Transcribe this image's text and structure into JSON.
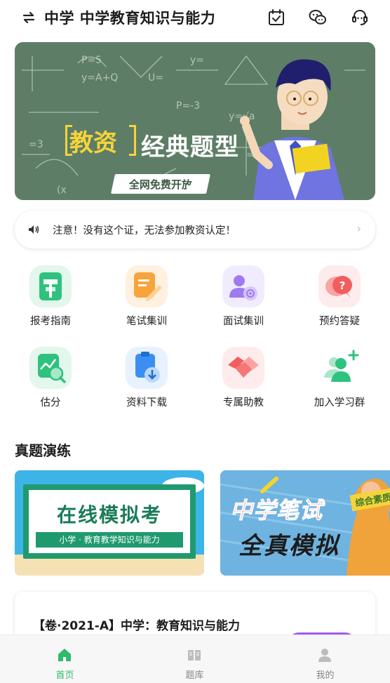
{
  "header": {
    "title": "中学 中学教育知识与能力",
    "icons": [
      "swap-icon",
      "calendar-check-icon",
      "wechat-icon",
      "customer-service-icon"
    ]
  },
  "banner": {
    "tag": "教资",
    "title": "经典题型",
    "ribbon": "全网免费开放",
    "slides": 2,
    "active_slide": 1
  },
  "notice": {
    "text": "注意！没有这个证，无法参加教资认定！"
  },
  "menu": [
    {
      "label": "报考指南",
      "icon": "signpost-icon"
    },
    {
      "label": "笔试集训",
      "icon": "notepad-pencil-icon"
    },
    {
      "label": "面试集训",
      "icon": "user-target-icon"
    },
    {
      "label": "预约答疑",
      "icon": "question-bubble-icon"
    },
    {
      "label": "估分",
      "icon": "chart-magnifier-icon"
    },
    {
      "label": "资料下载",
      "icon": "clipboard-download-icon"
    },
    {
      "label": "专属助教",
      "icon": "handshake-icon"
    },
    {
      "label": "加入学习群",
      "icon": "add-group-icon"
    }
  ],
  "section": {
    "title": "真题演练"
  },
  "cards": [
    {
      "title": "在线模拟考",
      "subtitle": "小学 · 教育教学知识与能力"
    },
    {
      "title_line1": "中学笔试",
      "title_line2": "全真模拟",
      "tag": "综合素质"
    }
  ],
  "paper": {
    "title": "【卷·2021-A】中学：教育知识与能力"
  },
  "tabbar": {
    "tabs": [
      {
        "label": "首页",
        "active": true
      },
      {
        "label": "题库",
        "active": false
      },
      {
        "label": "我的",
        "active": false
      }
    ]
  },
  "colors": {
    "accent_green": "#2dbb6d",
    "banner_green": "#5b7a64",
    "banner_yellow": "#f5d43a"
  }
}
